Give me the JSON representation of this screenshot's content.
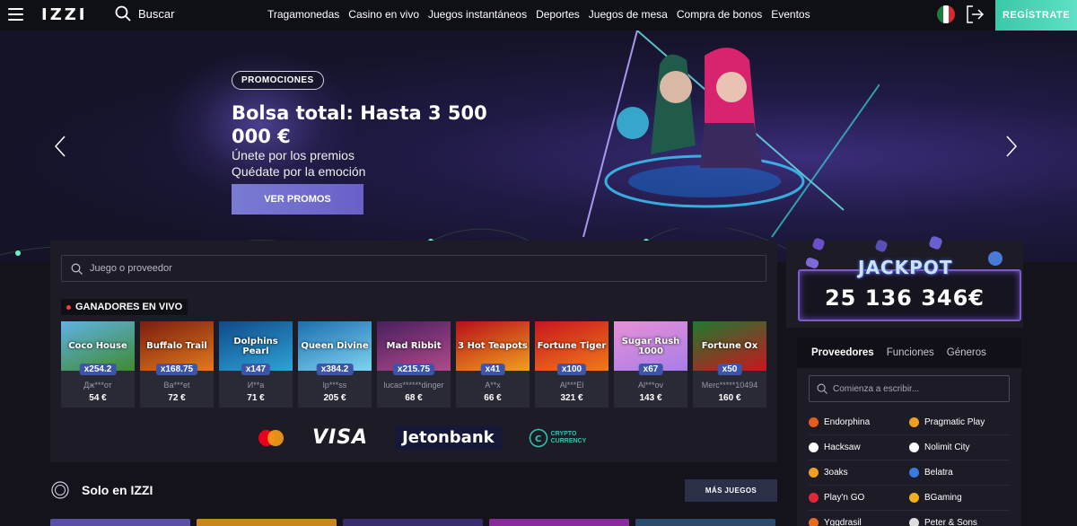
{
  "header": {
    "logo": "IZZI",
    "search_label": "Buscar",
    "nav": [
      "Tragamonedas",
      "Casino en vivo",
      "Juegos instantáneos",
      "Deportes",
      "Juegos de mesa",
      "Compra de bonos",
      "Eventos"
    ],
    "register_label": "REGÍSTRATE"
  },
  "hero": {
    "badge": "PROMOCIONES",
    "title": "Bolsa total: Hasta 3 500 000 €",
    "subtitle_1": "Únete por los premios",
    "subtitle_2": "Quédate por la emoción",
    "button": "VER PROMOS"
  },
  "game_search": {
    "placeholder": "Juego o proveedor"
  },
  "live_winners": {
    "title": "GANADORES EN VIVO",
    "items": [
      {
        "game": "Coco House",
        "mult": "x254.2",
        "user": "Дж***от",
        "amount": "54 €",
        "c1": "#5fb2e6",
        "c2": "#3f8a2e"
      },
      {
        "game": "Buffalo Trail",
        "mult": "x168.75",
        "user": "Ba***et",
        "amount": "72 €",
        "c1": "#7a1e0f",
        "c2": "#e27a1e"
      },
      {
        "game": "Dolphins Pearl",
        "mult": "x147",
        "user": "И**a",
        "amount": "71 €",
        "c1": "#0f4a8a",
        "c2": "#2fa3d6"
      },
      {
        "game": "Queen Divine",
        "mult": "x384.2",
        "user": "lp***ss",
        "amount": "205 €",
        "c1": "#1c6fb0",
        "c2": "#7fd3f0"
      },
      {
        "game": "Mad Ribbit",
        "mult": "x215.75",
        "user": "lucas******dinger",
        "amount": "68 €",
        "c1": "#4a1f5e",
        "c2": "#b04a8a"
      },
      {
        "game": "3 Hot Teapots",
        "mult": "x41",
        "user": "A**x",
        "amount": "66 €",
        "c1": "#b80f1a",
        "c2": "#f0a01e"
      },
      {
        "game": "Fortune Tiger",
        "mult": "x100",
        "user": "Al***El",
        "amount": "321 €",
        "c1": "#c8161e",
        "c2": "#f07a1a"
      },
      {
        "game": "Sugar Rush 1000",
        "mult": "x67",
        "user": "Al***ov",
        "amount": "143 €",
        "c1": "#e890d6",
        "c2": "#a77de8"
      },
      {
        "game": "Fortune Ox",
        "mult": "x50",
        "user": "Merc*****10494",
        "amount": "160 €",
        "c1": "#1e7a2e",
        "c2": "#c8161e"
      }
    ]
  },
  "payments": {
    "visa": "VISA",
    "jeton": "Jetonbank",
    "crypto_1": "CRYPTO",
    "crypto_2": "CURRENCY"
  },
  "solo": {
    "title": "Solo en IZZI",
    "more_button": "MÁS JUEGOS"
  },
  "jackpot": {
    "label": "JACKPOT",
    "amount": "25 136 346€"
  },
  "providers": {
    "tabs": [
      "Proveedores",
      "Funciones",
      "Géneros"
    ],
    "search_placeholder": "Comienza a escribir...",
    "rows": [
      [
        {
          "name": "Endorphina",
          "color": "#e85a1e"
        },
        {
          "name": "Pragmatic Play",
          "color": "#f0a01e"
        }
      ],
      [
        {
          "name": "Hacksaw",
          "color": "#ffffff"
        },
        {
          "name": "Nolimit City",
          "color": "#ffffff"
        }
      ],
      [
        {
          "name": "3oaks",
          "color": "#f0a01e"
        },
        {
          "name": "Belatra",
          "color": "#3a7ae0"
        }
      ],
      [
        {
          "name": "Play'n GO",
          "color": "#e0283a"
        },
        {
          "name": "BGaming",
          "color": "#f0b01e"
        }
      ],
      [
        {
          "name": "Yggdrasil",
          "color": "#e86a1e"
        },
        {
          "name": "Peter & Sons",
          "color": "#dddddd"
        }
      ]
    ]
  }
}
